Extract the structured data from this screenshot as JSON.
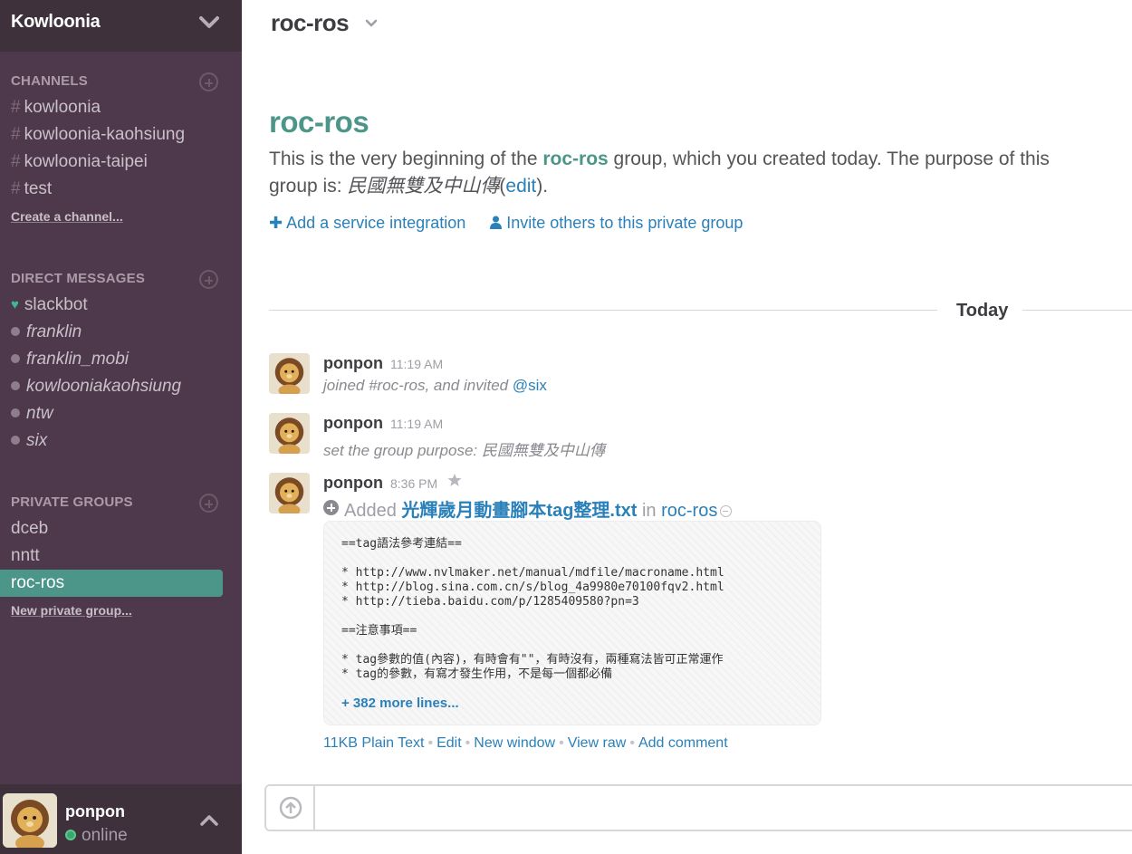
{
  "team": {
    "name": "Kowloonia"
  },
  "sidebar": {
    "channels": {
      "header": "CHANNELS",
      "items": [
        {
          "name": "kowloonia"
        },
        {
          "name": "kowloonia-kaohsiung"
        },
        {
          "name": "kowloonia-taipei"
        },
        {
          "name": "test"
        }
      ],
      "create_label": "Create a channel..."
    },
    "direct_messages": {
      "header": "DIRECT MESSAGES",
      "items": [
        {
          "name": "slackbot",
          "status": "bot"
        },
        {
          "name": "franklin",
          "status": "away"
        },
        {
          "name": "franklin_mobi",
          "status": "away"
        },
        {
          "name": "kowlooniakaohsiung",
          "status": "away"
        },
        {
          "name": "ntw",
          "status": "away"
        },
        {
          "name": "six",
          "status": "away"
        }
      ]
    },
    "private_groups": {
      "header": "PRIVATE GROUPS",
      "items": [
        {
          "name": "dceb"
        },
        {
          "name": "nntt"
        },
        {
          "name": "roc-ros",
          "active": true
        }
      ],
      "create_label": "New private group..."
    },
    "user": {
      "name": "ponpon",
      "status": "online"
    }
  },
  "channel": {
    "header": "roc-ros",
    "intro": {
      "title": "roc-ros",
      "text_part1": "This is the very beginning of the ",
      "group_name": "roc-ros",
      "text_part2": " group, which you created today. The purpose of this group is: ",
      "purpose": "民國無雙及中山傳",
      "edit_label": "edit",
      "add_integration": "Add a service integration",
      "invite_label": "Invite others to this private group"
    },
    "day_divider": "Today"
  },
  "messages": [
    {
      "author": "ponpon",
      "time": "11:19 AM",
      "text": "joined #roc-ros, and invited ",
      "mention": "@six"
    },
    {
      "author": "ponpon",
      "time": "11:19 AM",
      "text": "set the group purpose: 民國無雙及中山傳"
    },
    {
      "author": "ponpon",
      "time": "8:36 PM",
      "added_label": "Added",
      "file_title": "光輝歲月動畫腳本tag整理.txt",
      "in_label": "in",
      "channel_link": "roc-ros",
      "snippet": "==tag語法參考連結==\n\n* http://www.nvlmaker.net/manual/mdfile/macroname.html\n* http://blog.sina.com.cn/s/blog_4a9980e70100fqv2.html\n* http://tieba.baidu.com/p/1285409580?pn=3\n\n==注意事項==\n\n* tag參數的值(內容)，有時會有\"\"，有時沒有，兩種寫法皆可正常運作\n* tag的參數，有寫才發生作用，不是每一個都必備",
      "more_lines": "+ 382 more lines...",
      "actions": {
        "size_type": "11KB Plain Text",
        "edit": "Edit",
        "new_window": "New window",
        "view_raw": "View raw",
        "add_comment": "Add comment"
      }
    }
  ],
  "composer": {
    "placeholder": ""
  },
  "colors": {
    "sidebar_bg": "#4d394b",
    "sidebar_header_bg": "#3e313c",
    "accent_green": "#4c9689",
    "link_blue": "#2a80b9",
    "presence_online": "#3aa76d"
  }
}
